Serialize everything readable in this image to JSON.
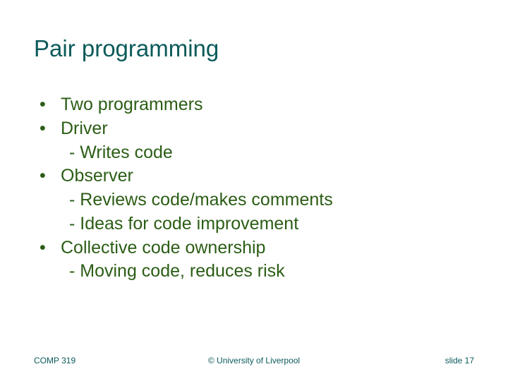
{
  "title": "Pair programming",
  "bullets": {
    "b0": "Two programmers",
    "b1": "Driver",
    "b1s0": "- Writes code",
    "b2": "Observer",
    "b2s0": "- Reviews code/makes comments",
    "b2s1": "- Ideas for code improvement",
    "b3": "Collective code ownership",
    "b3s0": "- Moving code, reduces risk"
  },
  "footer": {
    "course": "COMP 319",
    "copyright": "© University of Liverpool",
    "page_label": "slide 17"
  }
}
